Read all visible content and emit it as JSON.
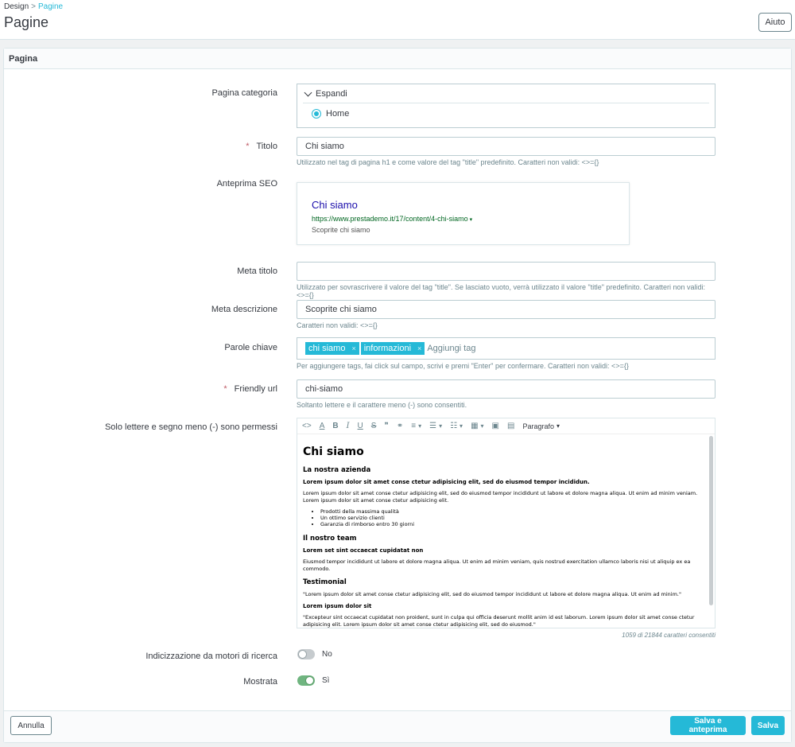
{
  "breadcrumb": {
    "parent": "Design",
    "separator": ">",
    "current": "Pagine"
  },
  "page_title": "Pagine",
  "help_button": "Aiuto",
  "card": {
    "title": "Pagina"
  },
  "fields": {
    "category": {
      "label": "Pagina categoria",
      "expand_label": "Espandi",
      "selected": "Home"
    },
    "title": {
      "label": "Titolo",
      "value": "Chi siamo",
      "help": "Utilizzato nel tag di pagina h1 e come valore del tag \"title\" predefinito. Caratteri non validi: <>={}"
    },
    "seo": {
      "label": "Anteprima SEO",
      "title": "Chi siamo",
      "url": "https://www.prestademo.it/17/content/4-chi-siamo",
      "url_caret": "▾",
      "description": "Scoprite chi siamo"
    },
    "meta_title": {
      "label": "Meta titolo",
      "value": "",
      "help": "Utilizzato per sovrascrivere il valore del tag \"title\". Se lasciato vuoto, verrà utilizzato il valore \"title\" predefinito. Caratteri non validi: <>={}"
    },
    "meta_description": {
      "label": "Meta descrizione",
      "value": "Scoprite chi siamo",
      "help": "Caratteri non validi: <>={}"
    },
    "keywords": {
      "label": "Parole chiave",
      "tags": [
        "chi siamo",
        "informazioni"
      ],
      "tag_remove": "×",
      "placeholder": "Aggiungi tag",
      "help": "Per aggiungere tags, fai click sul campo, scrivi e premi \"Enter\" per confermare. Caratteri non validi: <>={}"
    },
    "friendly_url": {
      "label": "Friendly url",
      "value": "chi-siamo",
      "help": "Soltanto lettere e il carattere meno (-) sono consentiti."
    },
    "content": {
      "label": "Solo lettere e segno meno (-) sono permessi",
      "toolbar": {
        "code": "<>",
        "color": "A",
        "bold": "B",
        "italic": "I",
        "underline": "U",
        "strike": "S",
        "quote": "❞",
        "link": "⚭",
        "align": "≡",
        "bullets": "☰",
        "numbers": "☷",
        "table": "▦",
        "image": "▣",
        "media": "▤",
        "paragraph": "Paragrafo"
      },
      "body": {
        "h1": "Chi siamo",
        "h2_company": "La nostra azienda",
        "h3_company": "Lorem ipsum dolor sit amet conse ctetur adipisicing elit, sed do eiusmod tempor incididun.",
        "p_company": "Lorem ipsum dolor sit amet conse ctetur adipisicing elit, sed do eiusmod tempor incididunt ut labore et dolore magna aliqua. Ut enim ad minim veniam. Lorem ipsum dolor sit amet conse ctetur adipisicing elit.",
        "list": [
          "Prodotti della massima qualità",
          "Un ottimo servizio clienti",
          "Garanzia di rimborso entro 30 giorni"
        ],
        "h2_team": "Il nostro team",
        "h3_team": "Lorem set sint occaecat cupidatat non",
        "p_team": "Eiusmod tempor incididunt ut labore et dolore magna aliqua. Ut enim ad minim veniam, quis nostrud exercitation ullamco laboris nisi ut aliquip ex ea commodo.",
        "h2_testimonial": "Testimonial",
        "p_testimonial1": "\"Lorem ipsum dolor sit amet conse ctetur adipisicing elit, sed do eiusmod tempor incididunt ut labore et dolore magna aliqua. Ut enim ad minim.\"",
        "h3_testimonial": "Lorem ipsum dolor sit",
        "p_testimonial2": "\"Excepteur sint occaecat cupidatat non proident, sunt in culpa qui officia deserunt mollit anim id est laborum. Lorem ipsum dolor sit amet conse ctetur adipisicing elit. Lorem ipsum dolor sit amet conse ctetur adipisicing elit, sed do eiusmod.\""
      },
      "counter": "1059 di 21844 caratteri consentiti"
    },
    "indexing": {
      "label": "Indicizzazione da motori di ricerca",
      "value_label": "No",
      "on": false
    },
    "displayed": {
      "label": "Mostrata",
      "value_label": "Sì",
      "on": true
    }
  },
  "footer": {
    "cancel": "Annulla",
    "save_preview": "Salva e anteprima",
    "save": "Salva"
  },
  "colors": {
    "accent": "#25b9d7",
    "switch_on": "#70b580",
    "required": "#c05c67"
  }
}
